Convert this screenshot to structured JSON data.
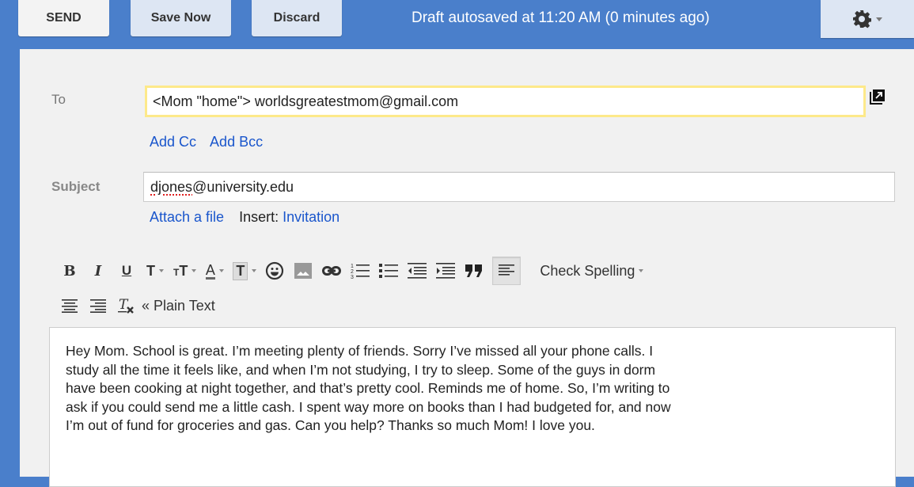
{
  "toolbar": {
    "send_label": "SEND",
    "save_label": "Save Now",
    "discard_label": "Discard",
    "status": "Draft autosaved at 11:20 AM (0 minutes ago)",
    "settings_icon": "gear-icon"
  },
  "compose": {
    "to_label": "To",
    "to_value": "<Mom \"home\"> worldsgreatestmom@gmail.com",
    "popout_icon": "popout-icon",
    "add_cc": "Add Cc",
    "add_bcc": "Add Bcc",
    "subject_label": "Subject",
    "subject_misspelled": "djones",
    "subject_rest": "@university.edu",
    "attach_label": "Attach a file",
    "insert_label": "Insert:",
    "invitation_label": "Invitation"
  },
  "format_toolbar": {
    "bold": "B",
    "italic": "I",
    "underline": "U",
    "font": "T",
    "size": "T",
    "text_color": "A",
    "highlight": "T",
    "check_spelling": "Check Spelling",
    "plain_text": "« Plain Text",
    "icons": [
      "bold-icon",
      "italic-icon",
      "underline-icon",
      "font-icon",
      "font-size-icon",
      "text-color-icon",
      "highlight-icon",
      "emoji-icon",
      "image-icon",
      "link-icon",
      "numbered-list-icon",
      "bulleted-list-icon",
      "indent-less-icon",
      "indent-more-icon",
      "quote-icon",
      "align-left-icon",
      "align-center-icon",
      "align-right-icon",
      "remove-formatting-icon"
    ]
  },
  "body": {
    "text": "Hey Mom. School is great. I’m meeting plenty of friends. Sorry I’ve missed all your phone calls. I\nstudy all the time it feels like, and when I’m not studying, I try to sleep. Some of the guys in dorm\nhave been cooking at night together, and that’s pretty cool. Reminds me of home. So, I’m writing to\nask if you could send me a little cash. I spent way more on books than I had budgeted for, and now\nI’m out of fund for groceries and gas. Can you help? Thanks so much Mom! I love you."
  },
  "colors": {
    "header_blue": "#4a7fcb",
    "link_blue": "#1a56cc",
    "focus_yellow": "#fde98a",
    "panel_gray": "#f1f1f1"
  }
}
